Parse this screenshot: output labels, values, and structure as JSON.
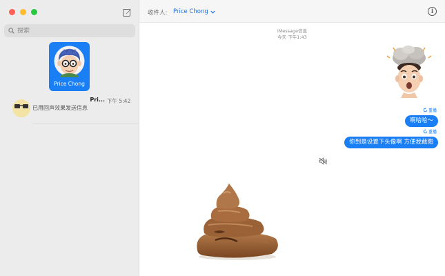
{
  "sidebar": {
    "search_placeholder": "搜索",
    "pinned": {
      "name": "Price Chong"
    },
    "conversations": [
      {
        "name": "Pri...",
        "time": "下午 5:42",
        "preview": "已用回声效果发送信息"
      }
    ]
  },
  "header": {
    "to_label": "收件人:",
    "recipient": "Price Chong"
  },
  "thread": {
    "service": "iMessage信息",
    "timestamp": "今天 下午1:43",
    "messages": [
      {
        "reply_tag": "重播",
        "text": "啊哈哈～"
      },
      {
        "reply_tag": "重播",
        "text": "你到是设置下头像啊 方便我截图"
      }
    ]
  },
  "colors": {
    "accent": "#1a7ef5",
    "sidebar_bg": "#ececec",
    "close": "#fe5f57",
    "minimize": "#febc2e",
    "zoom": "#28c840"
  }
}
